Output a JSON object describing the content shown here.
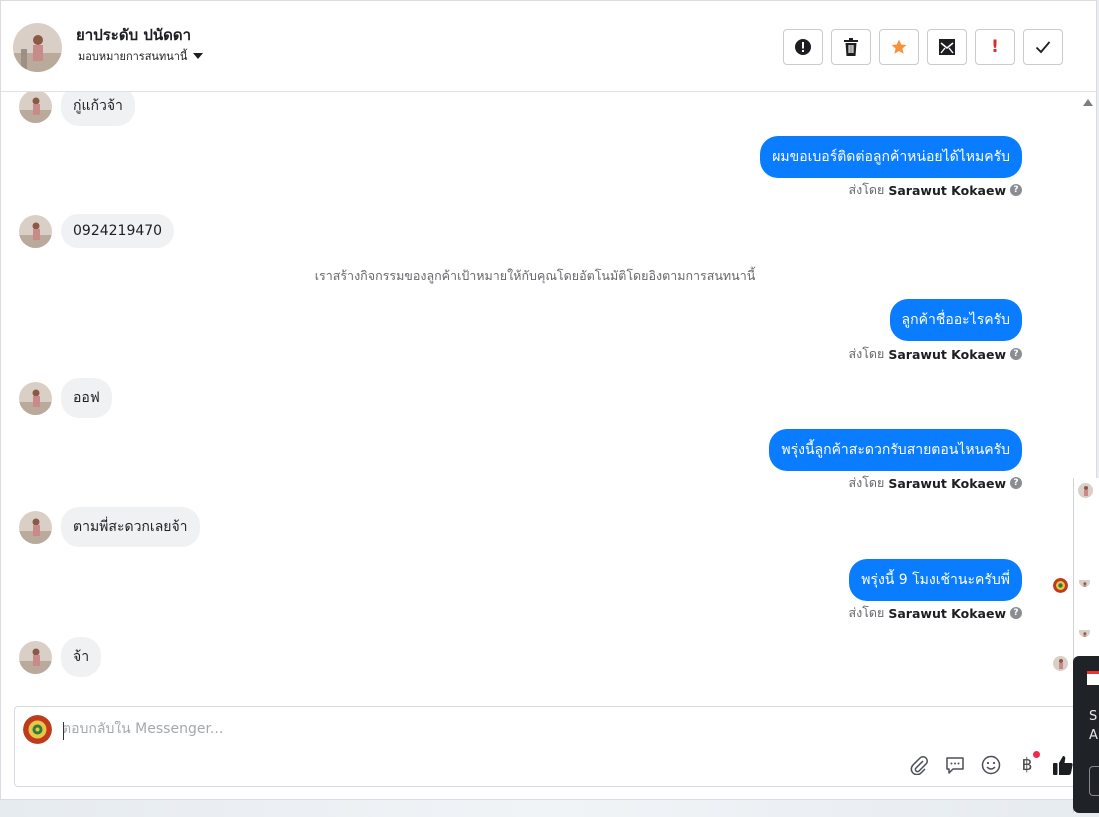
{
  "header": {
    "name": "ยาประดับ ปนัดดา",
    "assignment": "มอบหมายการสนทนานี้",
    "actions": [
      "alert-circle-icon",
      "trash-icon",
      "star-icon",
      "mark-unread-icon",
      "flag-spam-icon",
      "check-icon"
    ]
  },
  "colors": {
    "brand": "#0a7cff",
    "incoming": "#eff1f3",
    "star": "#f7923a",
    "danger": "#e02a2a"
  },
  "messages": [
    {
      "dir": "in",
      "text": "กู่แก้วจ้า"
    },
    {
      "dir": "out",
      "text": "ผมขอเบอร์ติดต่อลูกค้าหน่อยได้ไหมครับ",
      "sent_prefix": "ส่งโดย",
      "sender": "Sarawut Kokaew"
    },
    {
      "dir": "in",
      "text": "0924219470"
    },
    {
      "dir": "system",
      "text": "เราสร้างกิจกรรมของลูกค้าเป้าหมายให้กับคุณโดยอัตโนมัติโดยอิงตามการสนทนานี้"
    },
    {
      "dir": "out",
      "text": "ลูกค้าชื่ออะไรครับ",
      "sent_prefix": "ส่งโดย",
      "sender": "Sarawut Kokaew"
    },
    {
      "dir": "in",
      "text": "ออฟ"
    },
    {
      "dir": "out",
      "text": "พรุ่งนี้ลูกค้าสะดวกรับสายตอนไหนครับ",
      "sent_prefix": "ส่งโดย",
      "sender": "Sarawut Kokaew"
    },
    {
      "dir": "in",
      "text": "ตามพี่สะดวกเลยจ้า"
    },
    {
      "dir": "out",
      "text": "พรุ่งนี้ 9 โมงเช้านะครับพี่",
      "sent_prefix": "ส่งโดย",
      "sender": "Sarawut Kokaew"
    },
    {
      "dir": "in",
      "text": "จ้า"
    }
  ],
  "composer": {
    "placeholder": "ตอบกลับใน Messenger...",
    "tools": [
      "paperclip-icon",
      "saved-reply-icon",
      "emoji-icon",
      "baht-payment-icon",
      "thumbs-up-icon"
    ],
    "baht_symbol": "฿"
  },
  "side_panel": {
    "line1": "S",
    "line2": "A"
  }
}
